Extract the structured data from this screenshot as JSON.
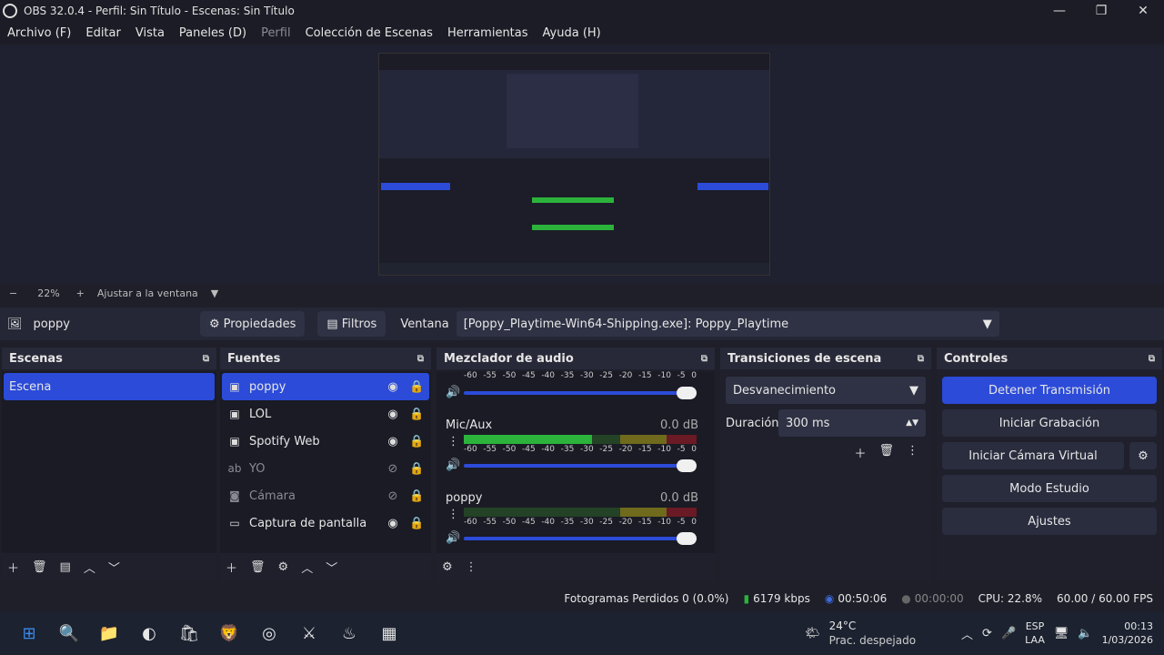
{
  "window": {
    "title": "OBS 32.0.4 - Perfil: Sin Título - Escenas: Sin Título"
  },
  "menu": [
    "Archivo (F)",
    "Editar",
    "Vista",
    "Paneles (D)",
    "Perfil",
    "Colección de Escenas",
    "Herramientas",
    "Ayuda (H)"
  ],
  "zoom": {
    "minus": "−",
    "value": "22%",
    "plus": "+",
    "fit": "Ajustar a la ventana"
  },
  "source_bar": {
    "name": "poppy",
    "props": "Propiedades",
    "filters": "Filtros",
    "window_label": "Ventana",
    "window_value": "[Poppy_Playtime-Win64-Shipping.exe]: Poppy_Playtime"
  },
  "scenes": {
    "title": "Escenas",
    "items": [
      "Escena"
    ]
  },
  "sources": {
    "title": "Fuentes",
    "items": [
      "poppy",
      "LOL",
      "Spotify Web",
      "YO",
      "Cámara",
      "Captura de pantalla"
    ]
  },
  "mixer": {
    "title": "Mezclador de audio",
    "scale": [
      "-60",
      "-55",
      "-50",
      "-45",
      "-40",
      "-35",
      "-30",
      "-25",
      "-20",
      "-15",
      "-10",
      "-5",
      "0"
    ],
    "channels": [
      {
        "name": "Mic/Aux",
        "db": "0.0 dB",
        "level": 0.55
      },
      {
        "name": "poppy",
        "db": "0.0 dB",
        "level": 0.0
      }
    ]
  },
  "transitions": {
    "title": "Transiciones de escena",
    "type": "Desvanecimiento",
    "duration_label": "Duración",
    "duration_value": "300 ms"
  },
  "controls": {
    "title": "Controles",
    "stop_stream": "Detener Transmisión",
    "start_record": "Iniciar Grabación",
    "virtual_cam": "Iniciar Cámara Virtual",
    "studio": "Modo Estudio",
    "settings": "Ajustes"
  },
  "status": {
    "dropped": "Fotogramas Perdidos 0 (0.0%)",
    "bitrate": "6179 kbps",
    "stream_time": "00:50:06",
    "rec_time": "00:00:00",
    "cpu": "CPU: 22.8%",
    "fps": "60.00 / 60.00 FPS"
  },
  "taskbar": {
    "temp": "24°C",
    "weather": "Prac. despejado",
    "lang": "ESP",
    "lang2": "LAA",
    "time": "00:13",
    "date": "1/03/2026"
  }
}
